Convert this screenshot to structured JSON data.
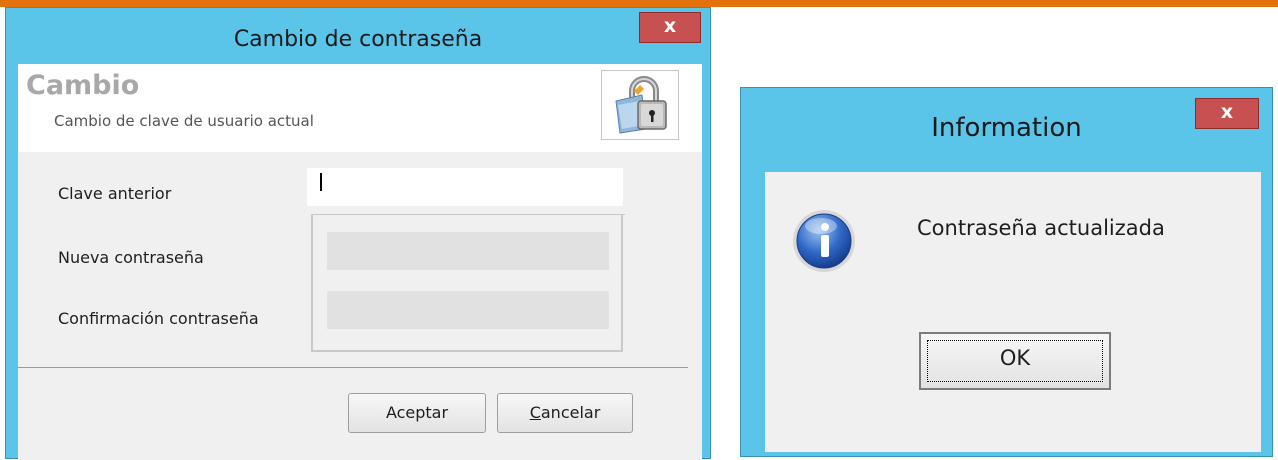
{
  "left_dialog": {
    "title": "Cambio de contraseña",
    "close_label": "x",
    "header": {
      "title": "Cambio",
      "subtitle": "Cambio de clave de usuario actual",
      "icon": "lock-key-icon"
    },
    "fields": {
      "old_password_label": "Clave anterior",
      "old_password_value": "",
      "new_password_label": "Nueva contraseña",
      "new_password_value": "",
      "confirm_password_label": "Confirmación contraseña",
      "confirm_password_value": ""
    },
    "buttons": {
      "accept": "Aceptar",
      "cancel_mnemonic": "C",
      "cancel_rest": "ancelar"
    }
  },
  "right_dialog": {
    "title": "Information",
    "close_label": "x",
    "icon": "info-icon",
    "message": "Contraseña actualizada",
    "ok_label": "OK"
  },
  "colors": {
    "title_bar": "#5bc4e9",
    "close_button": "#c75050",
    "top_accent": "#e3720e",
    "client_bg": "#f0f0f0"
  }
}
